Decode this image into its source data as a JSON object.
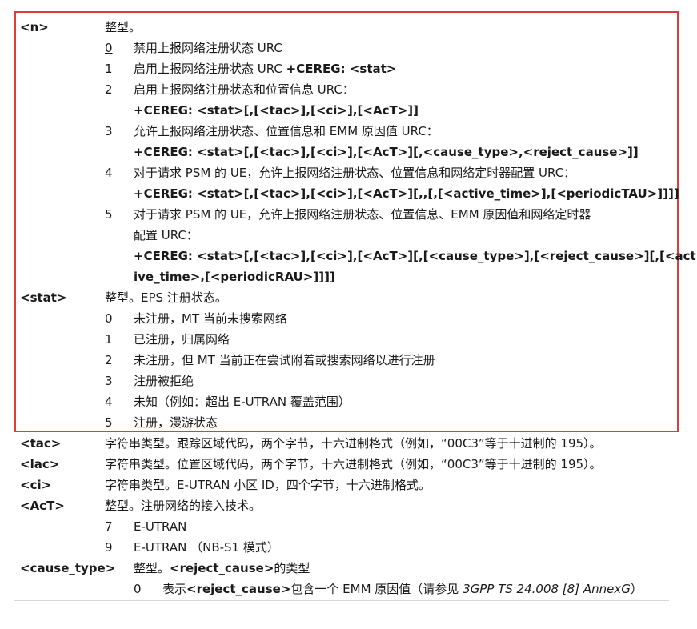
{
  "params": {
    "n": {
      "name": "<n>",
      "desc": "整型。",
      "items": [
        {
          "num": "0",
          "text": "禁用上报网络注册状态 URC"
        },
        {
          "num": "1",
          "text": "启用上报网络注册状态 URC ",
          "bold": "+CEREG: <stat>"
        },
        {
          "num": "2",
          "text": "启用上报网络注册状态和位置信息 URC：",
          "line2": "+CEREG: <stat>[,[<tac>],[<ci>],[<AcT>]]"
        },
        {
          "num": "3",
          "text": "允许上报网络注册状态、位置信息和 EMM 原因值 URC：",
          "line2": "+CEREG: <stat>[,[<tac>],[<ci>],[<AcT>][,<cause_type>,<reject_cause>]]"
        },
        {
          "num": "4",
          "text": "对于请求 PSM 的 UE，允许上报网络注册状态、位置信息和网络定时器配置 URC：",
          "line2": "+CEREG:  <stat>[,[<tac>],[<ci>],[<AcT>][,,[,[<active_time>],[<periodicTAU>]]]]"
        },
        {
          "num": "5",
          "text": "对于请求 PSM 的 UE，允许上报网络注册状态、位置信息、EMM 原因值和网络定时器",
          "line2": "配置 URC：",
          "line3": "+CEREG:  <stat>[,[<tac>],[<ci>],[<AcT>][,[<cause_type>],[<reject_cause>][,[<act",
          "line4": "ive_time>,[<periodicRAU>]]]]"
        }
      ]
    },
    "stat": {
      "name": "<stat>",
      "desc": "整型。EPS 注册状态。",
      "items": [
        {
          "num": "0",
          "text": "未注册，MT 当前未搜索网络"
        },
        {
          "num": "1",
          "text": "已注册，归属网络"
        },
        {
          "num": "2",
          "text": "未注册，但 MT 当前正在尝试附着或搜索网络以进行注册"
        },
        {
          "num": "3",
          "text": "注册被拒绝"
        },
        {
          "num": "4",
          "text": "未知（例如：超出 E-UTRAN 覆盖范围）"
        },
        {
          "num": "5",
          "text": "注册，漫游状态"
        }
      ]
    },
    "tac": {
      "name": "<tac>",
      "desc": "字符串类型。跟踪区域代码，两个字节，十六进制格式（例如，“00C3”等于十进制的 195）。"
    },
    "lac": {
      "name": "<lac>",
      "desc": "字符串类型。位置区域代码，两个字节，十六进制格式（例如，“00C3”等于十进制的 195）。"
    },
    "ci": {
      "name": "<ci>",
      "desc": "字符串类型。E-UTRAN 小区 ID，四个字节，十六进制格式。"
    },
    "act": {
      "name": "<AcT>",
      "desc": "整型。注册网络的接入技术。",
      "items": [
        {
          "num": "7",
          "text": "E-UTRAN"
        },
        {
          "num": "9",
          "text": "E-UTRAN （NB-S1 模式）"
        }
      ]
    },
    "cause_type": {
      "name": "<cause_type>",
      "desc_pre": "整型。",
      "desc_bold": "<reject_cause>",
      "desc_post": "的类型",
      "items": [
        {
          "num": "0",
          "pre": "表示",
          "bold": "<reject_cause>",
          "post": "包含一个 EMM 原因值（请参见 ",
          "ital": "3GPP TS 24.008 [8] AnnexG",
          "end": "）"
        }
      ]
    }
  },
  "colors": {
    "highlight_border": "#e03c3c",
    "text": "#1a1a1a"
  }
}
